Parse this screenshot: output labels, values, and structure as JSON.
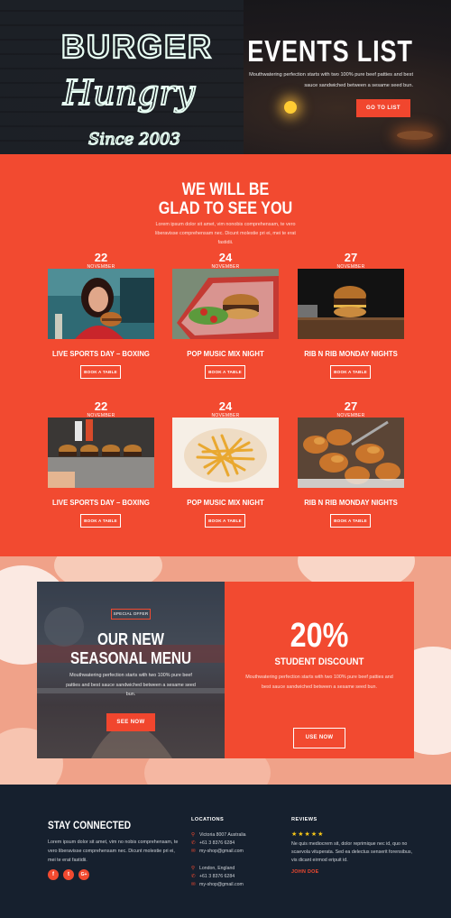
{
  "hero": {
    "neon_line1": "BURGER",
    "neon_line2": "Hungry",
    "neon_line3": "Since 2003",
    "title": "EVENTS LIST",
    "description": "Mouthwatering perfection starts with two 100% pure beef patties and best sauce sandwiched between a sesame seed bun.",
    "button": "GO TO LIST"
  },
  "events": {
    "title_line1": "WE WILL BE",
    "title_line2": "GLAD TO SEE YOU",
    "subtitle": "Lorem ipsum dolor sit amet, vim nonobis comprehensam, te vero liberavisse comprehensam nec. Dicunt molestie pri ei, mei te erat fastidii.",
    "cards": [
      {
        "day": "22",
        "month": "NOVEMBER",
        "name": "LIVE SPORTS DAY – BOXING",
        "button": "BOOK A TABLE",
        "image": "woman-eating-burger"
      },
      {
        "day": "24",
        "month": "NOVEMBER",
        "name": "POP MUSIC MIX NIGHT",
        "button": "BOOK A TABLE",
        "image": "burger-basket"
      },
      {
        "day": "27",
        "month": "NOVEMBER",
        "name": "RIB N RIB MONDAY NIGHTS",
        "button": "BOOK A TABLE",
        "image": "burger-on-board"
      },
      {
        "day": "22",
        "month": "NOVEMBER",
        "name": "LIVE SPORTS DAY – BOXING",
        "button": "BOOK A TABLE",
        "image": "burgers-counter"
      },
      {
        "day": "24",
        "month": "NOVEMBER",
        "name": "POP MUSIC MIX NIGHT",
        "button": "BOOK A TABLE",
        "image": "french-fries"
      },
      {
        "day": "27",
        "month": "NOVEMBER",
        "name": "RIB N RIB MONDAY NIGHTS",
        "button": "BOOK A TABLE",
        "image": "fried-chicken"
      }
    ]
  },
  "offer": {
    "tag": "SPECIAL OFFER",
    "title_line1": "OUR NEW",
    "title_line2": "SEASONAL MENU",
    "description": "Mouthwatering perfection starts with two 100% pure beef patties and best sauce sandwiched between a sesame seed bun.",
    "button": "SEE NOW",
    "percent": "20%",
    "discount_title": "STUDENT DISCOUNT",
    "discount_desc": "Mouthwatering perfection starts with two 100% pure beef patties and best sauce sandwiched between a sesame seed bun.",
    "discount_button": "USE NOW"
  },
  "footer": {
    "title": "STAY CONNECTED",
    "text": "Lorem ipsum dolor sit amet, vim no nobis comprehensam, te vero liberavisse comprehensam nec. Dicunt molestie pri ei, mei te erat fastidii.",
    "social": [
      {
        "icon": "facebook-icon",
        "glyph": "f"
      },
      {
        "icon": "twitter-icon",
        "glyph": "t"
      },
      {
        "icon": "google-plus-icon",
        "glyph": "G+"
      }
    ],
    "locations_heading": "LOCATIONS",
    "locations": [
      {
        "address": "Victoria 8007 Australia",
        "phone": "+61 3 8376 6284",
        "email": "my-shop@gmail.com"
      },
      {
        "address": "London, England",
        "phone": "+61 3 8376 6284",
        "email": "my-shop@gmail.com"
      }
    ],
    "reviews_heading": "REVIEWS",
    "stars": "★★★★★",
    "review_text": "Ne quis mediocrem sit, dolor reprimique nec id, quo no scaevola vituperata. Sed ea delectus senserit forensibus, vis dicant eirmod eripuit id.",
    "review_author": "JOHN DOE"
  },
  "colors": {
    "accent": "#f24a30",
    "footer_bg": "#16202e",
    "star": "#f5c518"
  }
}
